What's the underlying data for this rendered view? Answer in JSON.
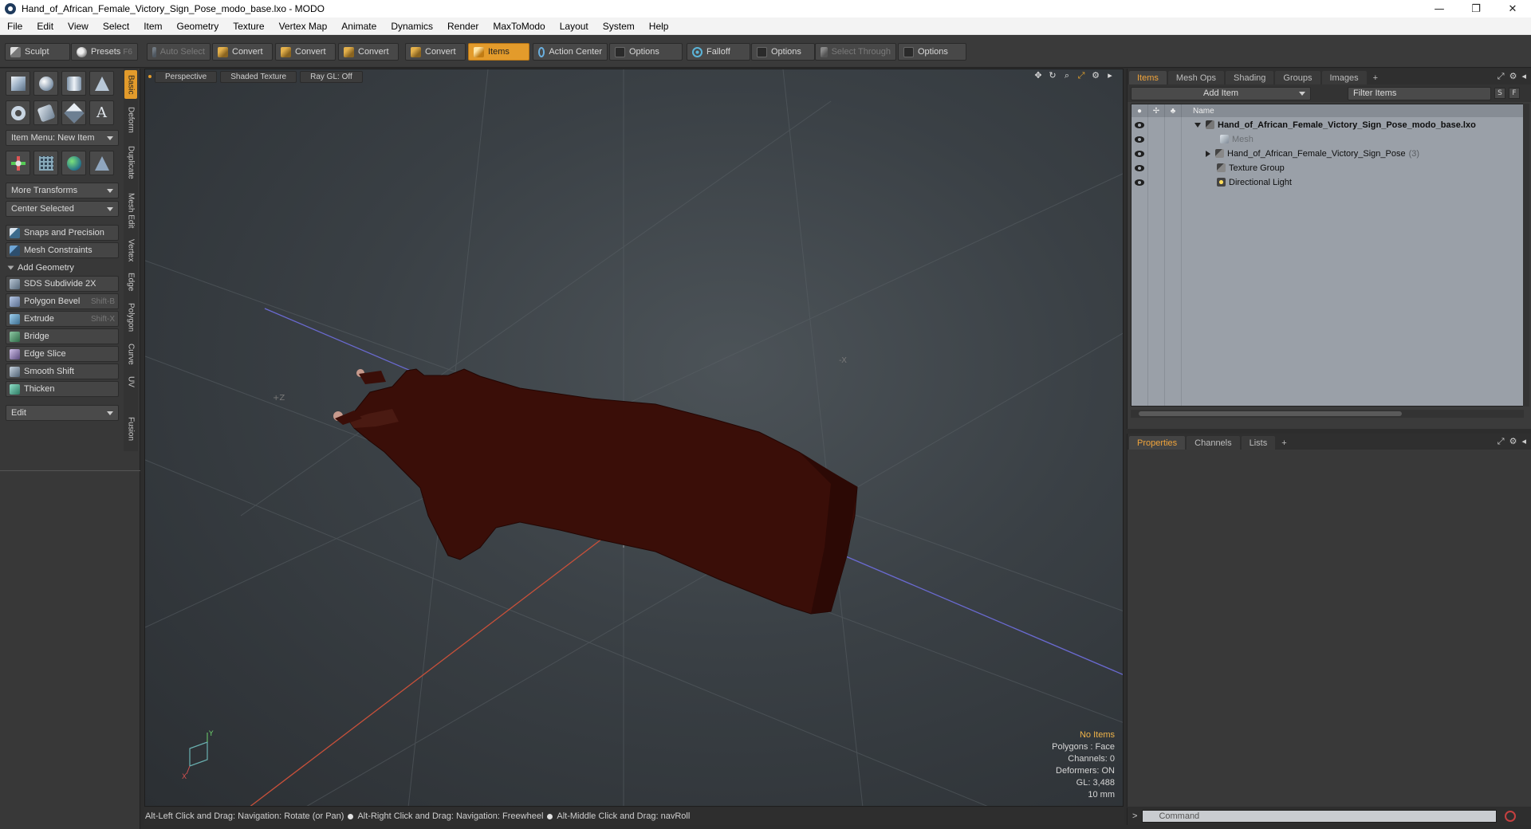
{
  "window": {
    "title": "Hand_of_African_Female_Victory_Sign_Pose_modo_base.lxo - MODO",
    "controls": [
      "—",
      "❐",
      "✕"
    ]
  },
  "menu": [
    "File",
    "Edit",
    "View",
    "Select",
    "Item",
    "Geometry",
    "Texture",
    "Vertex Map",
    "Animate",
    "Dynamics",
    "Render",
    "MaxToModo",
    "Layout",
    "System",
    "Help"
  ],
  "toolbar": {
    "sculpt": "Sculpt",
    "presets": "Presets",
    "presets_key": "F6",
    "auto_select": "Auto Select",
    "convert1": "Convert",
    "convert2": "Convert",
    "convert3": "Convert",
    "convert4": "Convert",
    "items": "Items",
    "action_center": "Action Center",
    "options1": "Options",
    "falloff": "Falloff",
    "options2": "Options",
    "select_through": "Select Through",
    "options3": "Options"
  },
  "left_panel": {
    "item_menu": "Item Menu: New Item",
    "more_transforms": "More Transforms",
    "center_selected": "Center Selected",
    "snaps": "Snaps and Precision",
    "mesh_constraints": "Mesh Constraints",
    "add_geometry": "Add Geometry",
    "tools": [
      {
        "label": "SDS Subdivide 2X",
        "key": ""
      },
      {
        "label": "Polygon Bevel",
        "key": "Shift-B"
      },
      {
        "label": "Extrude",
        "key": "Shift-X"
      },
      {
        "label": "Bridge",
        "key": ""
      },
      {
        "label": "Edge Slice",
        "key": ""
      },
      {
        "label": "Smooth Shift",
        "key": ""
      },
      {
        "label": "Thicken",
        "key": ""
      }
    ],
    "edit": "Edit",
    "vtabs": [
      "Basic",
      "Deform",
      "Duplicate",
      "Mesh Edit",
      "Vertex",
      "Edge",
      "Polygon",
      "Curve",
      "UV",
      "Fusion"
    ]
  },
  "viewport": {
    "view": "Perspective",
    "shading": "Shaded Texture",
    "raygl": "Ray GL: Off",
    "axis_labels": {
      "pz": "+Z",
      "nx": "-X"
    },
    "stats": {
      "items": "No Items",
      "polygons": "Polygons : Face",
      "channels": "Channels: 0",
      "deformers": "Deformers: ON",
      "gl": "GL: 3,488",
      "unit": "10 mm"
    },
    "colors": {
      "mesh": "#3a0e08",
      "x_axis": "#c8503a",
      "z_axis": "#6a6ad0"
    }
  },
  "status": {
    "hint1": "Alt-Left Click and Drag: Navigation: Rotate (or Pan)",
    "hint2": "Alt-Right Click and Drag: Navigation: Freewheel",
    "hint3": "Alt-Middle Click and Drag: navRoll"
  },
  "items_panel": {
    "tabs": [
      "Items",
      "Mesh Ops",
      "Shading",
      "Groups",
      "Images",
      "+"
    ],
    "add_item": "Add Item",
    "filter": "Filter Items",
    "s": "S",
    "f": "F",
    "col_name": "Name",
    "rows": [
      {
        "label": "Hand_of_African_Female_Victory_Sign_Pose_modo_base.lxo",
        "count": ""
      },
      {
        "label": "Mesh",
        "count": ""
      },
      {
        "label": "Hand_of_African_Female_Victory_Sign_Pose",
        "count": "(3)"
      },
      {
        "label": "Texture Group",
        "count": ""
      },
      {
        "label": "Directional Light",
        "count": ""
      }
    ]
  },
  "props_panel": {
    "tabs": [
      "Properties",
      "Channels",
      "Lists",
      "+"
    ]
  },
  "command": {
    "prompt": ">",
    "placeholder": "Command"
  }
}
